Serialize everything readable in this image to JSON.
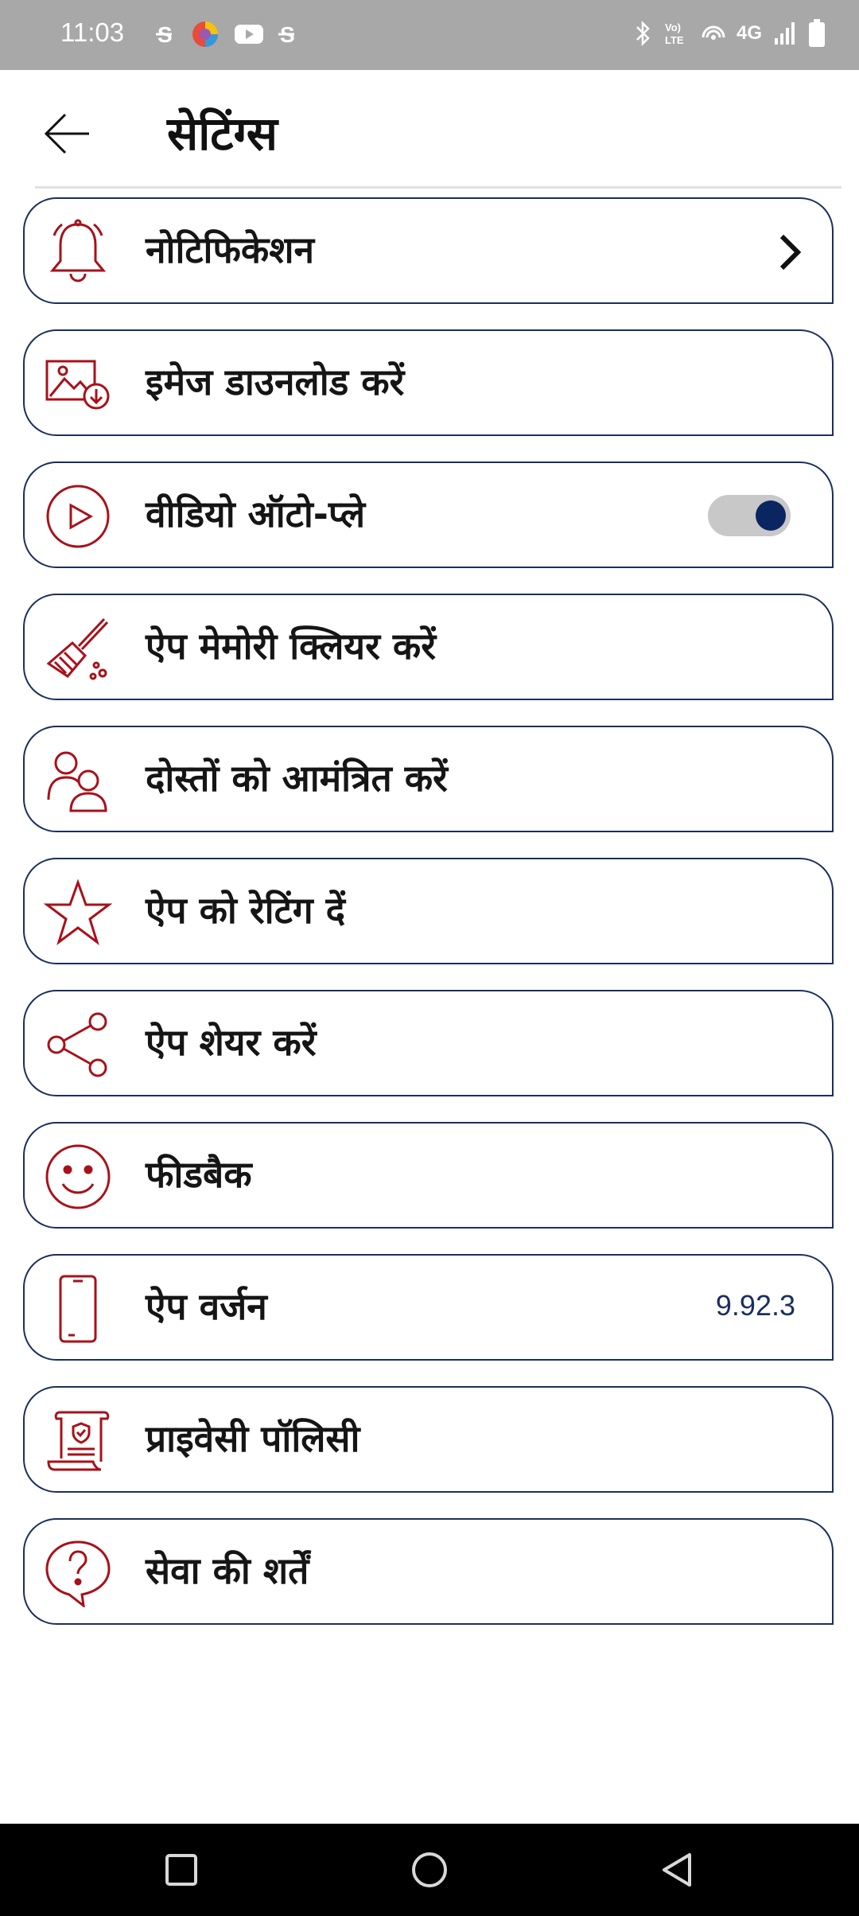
{
  "status_bar": {
    "time": "11:03",
    "network": "4G",
    "left_icons": [
      "sim-icon",
      "browser-icon",
      "youtube-icon",
      "sim-icon"
    ],
    "right_icons": [
      "bluetooth-icon",
      "volte-icon",
      "hotspot-icon",
      "signal-icon",
      "battery-icon"
    ]
  },
  "header": {
    "title": "सेटिंग्स",
    "back_icon": "arrow-left-icon"
  },
  "settings": [
    {
      "label": "नोटिफिकेशन",
      "icon": "bell-icon",
      "trailing": "chevron"
    },
    {
      "label": "इमेज डाउनलोड करें",
      "icon": "image-download-icon"
    },
    {
      "label": "वीडियो ऑटो-प्ले",
      "icon": "play-icon",
      "trailing": "toggle",
      "toggle_on": true
    },
    {
      "label": "ऐप मेमोरी क्लियर करें",
      "icon": "broom-icon"
    },
    {
      "label": "दोस्तों को आमंत्रित करें",
      "icon": "people-icon"
    },
    {
      "label": "ऐप को रेटिंग दें",
      "icon": "star-icon"
    },
    {
      "label": "ऐप शेयर करें",
      "icon": "share-icon"
    },
    {
      "label": "फीडबैक",
      "icon": "smiley-icon"
    },
    {
      "label": "ऐप वर्जन",
      "icon": "phone-icon",
      "value": "9.92.3"
    },
    {
      "label": "प्राइवेसी पॉलिसी",
      "icon": "document-shield-icon"
    },
    {
      "label": "सेवा की शर्तें",
      "icon": "question-bubble-icon"
    }
  ],
  "colors": {
    "accent": "#a8111a",
    "border": "#1b2f5e",
    "toggle_knob": "#0b2560",
    "status_bar": "#a8a8a8"
  },
  "nav_bar": {
    "buttons": [
      "recents-square-icon",
      "home-circle-icon",
      "back-triangle-icon"
    ]
  }
}
